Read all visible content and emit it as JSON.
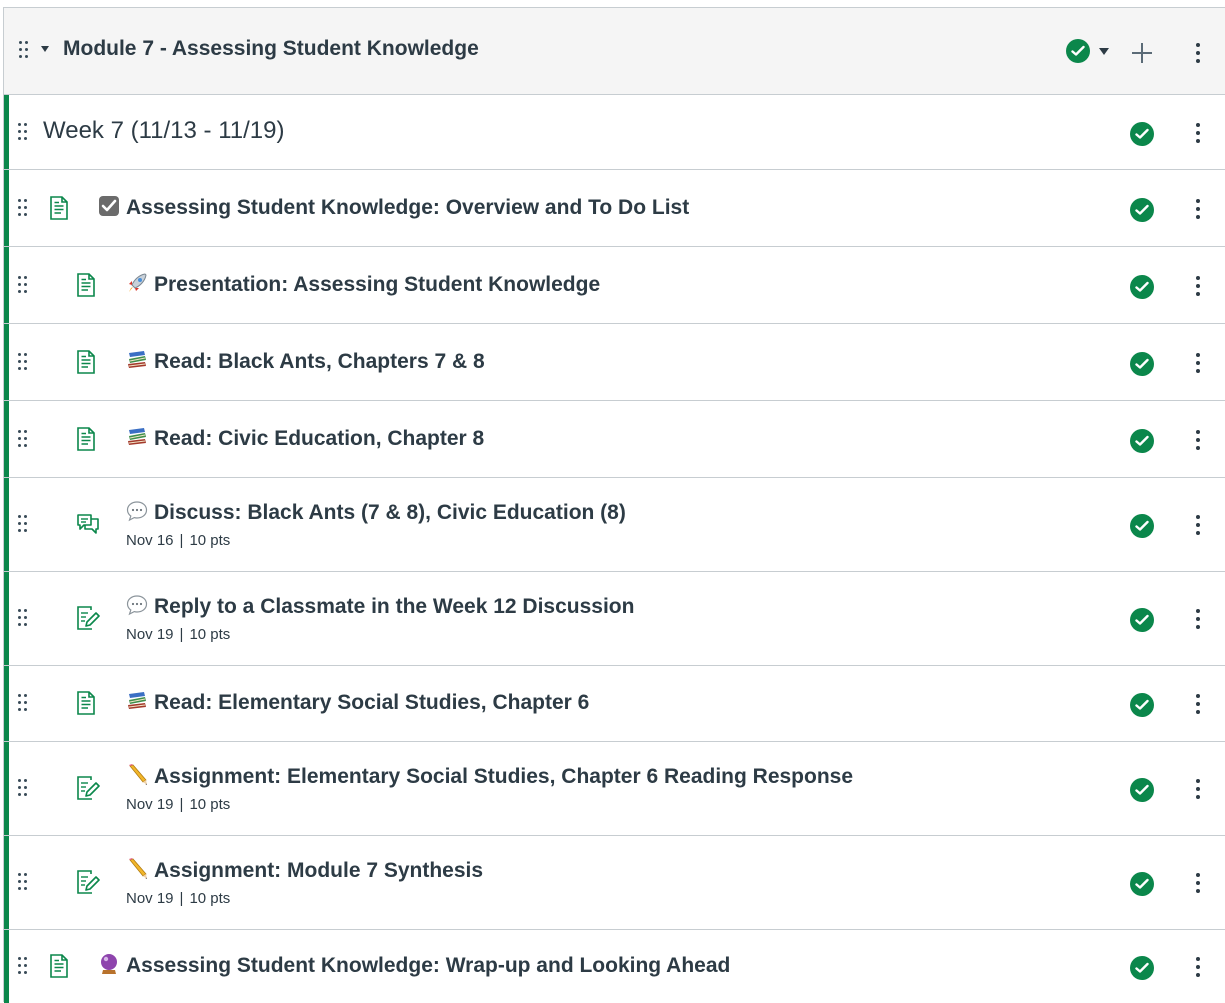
{
  "module": {
    "title": "Module 7 - Assessing Student Knowledge"
  },
  "subheader": {
    "title": "Week 7 (11/13 - 11/19)"
  },
  "items": [
    {
      "icon": "page-icon",
      "emoji": "check-box-emoji",
      "title": "Assessing Student Knowledge: Overview and To Do List"
    },
    {
      "icon": "page-icon",
      "emoji": "rocket-emoji",
      "title": "Presentation: Assessing Student Knowledge"
    },
    {
      "icon": "page-icon",
      "emoji": "books-emoji",
      "title": "Read: Black Ants, Chapters 7 & 8"
    },
    {
      "icon": "page-icon",
      "emoji": "books-emoji",
      "title": "Read: Civic Education, Chapter 8"
    },
    {
      "icon": "discussion-icon",
      "emoji": "speech-bubble-emoji",
      "title": "Discuss: Black Ants (7 & 8), Civic Education (8)",
      "date": "Nov 16",
      "sep": "|",
      "points": "10 pts"
    },
    {
      "icon": "assignment-icon",
      "emoji": "speech-bubble-emoji",
      "title": "Reply to a Classmate in the Week 12 Discussion",
      "date": "Nov 19",
      "sep": "|",
      "points": "10 pts"
    },
    {
      "icon": "page-icon",
      "emoji": "books-emoji",
      "title": "Read: Elementary Social Studies, Chapter 6"
    },
    {
      "icon": "assignment-icon",
      "emoji": "pencil-emoji",
      "title": "Assignment: Elementary Social Studies, Chapter 6 Reading Response",
      "date": "Nov 19",
      "sep": "|",
      "points": "10 pts"
    },
    {
      "icon": "assignment-icon",
      "emoji": "pencil-emoji",
      "title": "Assignment: Module 7 Synthesis",
      "date": "Nov 19",
      "sep": "|",
      "points": "10 pts"
    },
    {
      "icon": "page-icon",
      "emoji": "crystal-ball-emoji",
      "title": "Assessing Student Knowledge: Wrap-up and Looking Ahead"
    }
  ],
  "colors": {
    "published": "#0b874b",
    "text": "#2d3b45",
    "header_bg": "#f5f5f5",
    "border": "#c7cdd1"
  }
}
